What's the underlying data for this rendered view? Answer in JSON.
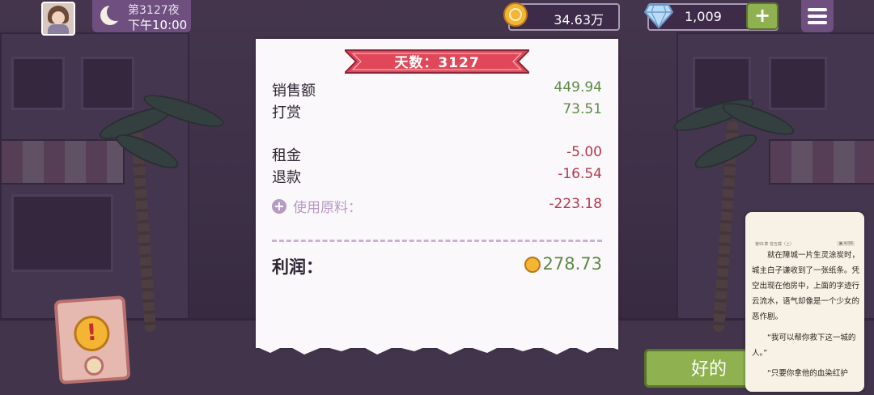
{
  "hud": {
    "avatar_icon": "player-avatar",
    "night_icon": "moon-icon",
    "night_label": "第3127夜",
    "time_label": "下午10:00",
    "coins": "34.63万",
    "gems": "1,009",
    "add_gems_label": "+",
    "menu_icon": "hamburger-menu-icon"
  },
  "receipt": {
    "title": "天数：3127",
    "rows": [
      {
        "label": "销售额",
        "value": "449.94"
      },
      {
        "label": "打赏",
        "value": "73.51"
      },
      {
        "label": "租金",
        "value": "-5.00"
      },
      {
        "label": "退款",
        "value": "-16.54"
      }
    ],
    "materials_label": "使用原料：",
    "materials_value": "-223.18",
    "profit_label": "利润：",
    "profit_value": "278.73"
  },
  "ok_button": "好的",
  "alert_icon": "exclamation-icon",
  "reader": {
    "header": "第91章 曾五载（上）",
    "badge": "▣ 4/36",
    "paragraphs": [
      "就在障城一片生灵涂炭时，城主白子谦收到了一张纸条。凭空出现在他房中，上面的字迹行云流水，语气却像是一个少女的恶作剧。",
      "“我可以帮你救下这一城的人。”",
      "“只要你拿他的血染红护"
    ]
  },
  "colors": {
    "positive": "#5e8a46",
    "negative": "#b23a4e",
    "ribbon": "#e0485a",
    "button_green": "#8fb14f",
    "panel_purple": "#6e4f7f"
  }
}
